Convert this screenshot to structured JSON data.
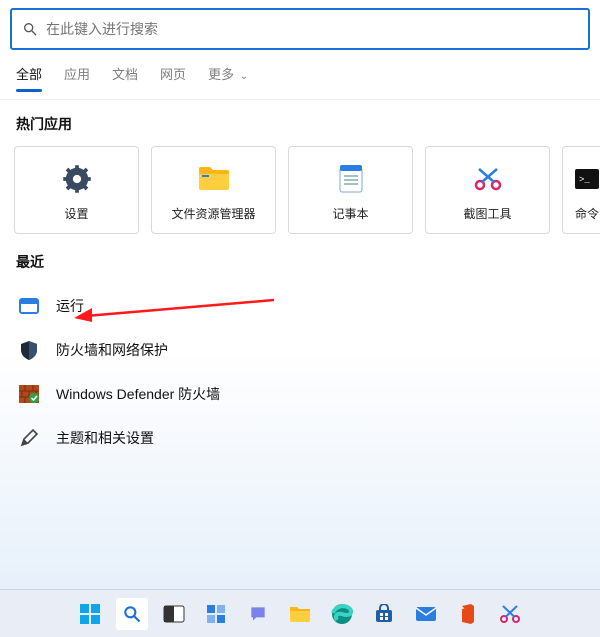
{
  "search": {
    "placeholder": "在此键入进行搜索"
  },
  "tabs": {
    "all": "全部",
    "apps": "应用",
    "docs": "文档",
    "web": "网页",
    "more": "更多"
  },
  "sections": {
    "top_apps": "热门应用",
    "recent": "最近"
  },
  "top_apps": {
    "settings": "设置",
    "explorer": "文件资源管理器",
    "notepad": "记事本",
    "snip": "截图工具",
    "cmd": "命令"
  },
  "recent": {
    "run": "运行",
    "firewall": "防火墙和网络保护",
    "defender_fw": "Windows Defender 防火墙",
    "themes": "主题和相关设置"
  },
  "colors": {
    "accent": "#1a6fd8"
  }
}
